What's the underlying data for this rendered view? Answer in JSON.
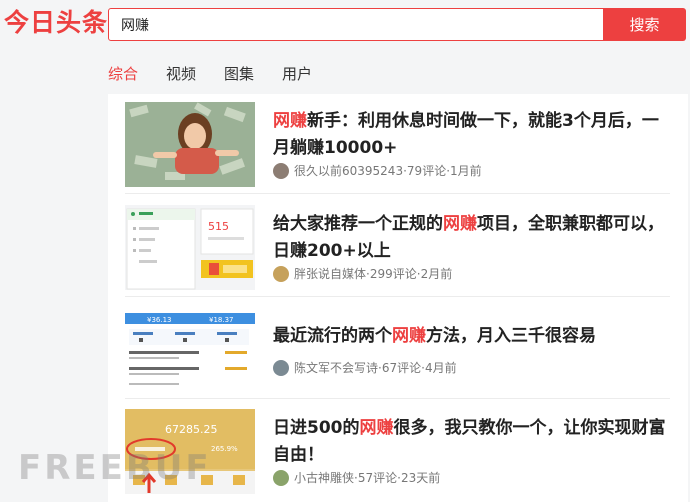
{
  "header": {
    "logo": "今日头条",
    "search_value": "网赚",
    "search_button": "搜索"
  },
  "tabs": [
    {
      "label": "综合",
      "active": true
    },
    {
      "label": "视频",
      "active": false
    },
    {
      "label": "图集",
      "active": false
    },
    {
      "label": "用户",
      "active": false
    }
  ],
  "articles": [
    {
      "title_pre": "",
      "title_hl": "网赚",
      "title_post": "新手：利用休息时间做一下，就能3个月后，一月躺赚10000+",
      "author": "很久以前60395243",
      "comments": "79评论",
      "time": "1月前"
    },
    {
      "title_pre": "给大家推荐一个正规的",
      "title_hl": "网赚",
      "title_post": "项目，全职兼职都可以，日赚200+以上",
      "author": "胖张说自媒体",
      "comments": "299评论",
      "time": "2月前",
      "thumb_values": {
        "amount": "515"
      }
    },
    {
      "title_pre": "最近流行的两个",
      "title_hl": "网赚",
      "title_post": "方法，月入三千很容易",
      "author": "陈文军不会写诗",
      "comments": "67评论",
      "time": "4月前",
      "thumb_values": {
        "left": "¥36.13",
        "right": "¥18.37"
      }
    },
    {
      "title_pre": "日进500的",
      "title_hl": "网赚",
      "title_post": "很多，我只教你一个，让你实现财富自由！",
      "author": "小古神雕侠",
      "comments": "57评论",
      "time": "23天前",
      "thumb_values": {
        "big": "67285.25",
        "sub": "265.9%"
      }
    }
  ],
  "meta_separator": " · ",
  "colors": {
    "brand": "#ed4040"
  },
  "watermark": "FREEBUF"
}
